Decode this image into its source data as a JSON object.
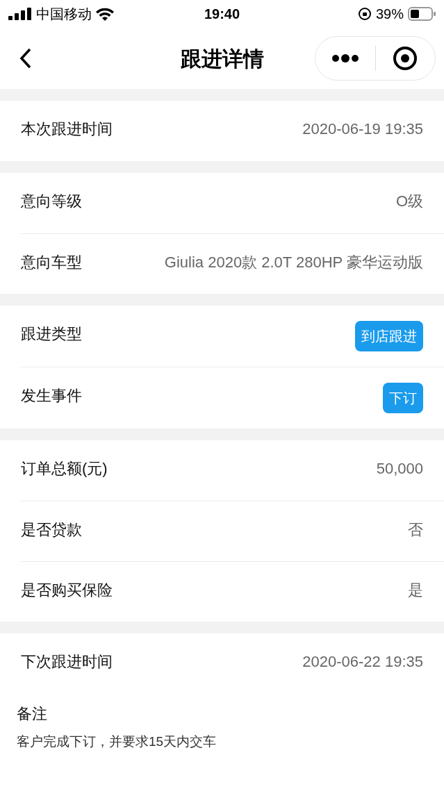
{
  "status_bar": {
    "carrier": "中国移动",
    "time": "19:40",
    "battery": "39%"
  },
  "nav": {
    "title": "跟进详情"
  },
  "sections": [
    {
      "rows": [
        {
          "kind": "text",
          "label": "本次跟进时间",
          "value": "2020-06-19 19:35"
        }
      ]
    },
    {
      "rows": [
        {
          "kind": "text",
          "label": "意向等级",
          "value": "O级"
        },
        {
          "kind": "text",
          "label": "意向车型",
          "value": "Giulia 2020款 2.0T 280HP 豪华运动版"
        }
      ]
    },
    {
      "rows": [
        {
          "kind": "tag",
          "label": "跟进类型",
          "value": "到店跟进"
        },
        {
          "kind": "tag",
          "label": "发生事件",
          "value": "下订"
        }
      ]
    },
    {
      "rows": [
        {
          "kind": "text",
          "label": "订单总额(元)",
          "value": "50,000"
        },
        {
          "kind": "text",
          "label": "是否贷款",
          "value": "否"
        },
        {
          "kind": "text",
          "label": "是否购买保险",
          "value": "是"
        }
      ]
    },
    {
      "rows": [
        {
          "kind": "text",
          "label": "下次跟进时间",
          "value": "2020-06-22 19:35"
        }
      ]
    }
  ],
  "remark": {
    "label": "备注",
    "text": "客户完成下订，并要求15天内交车"
  }
}
